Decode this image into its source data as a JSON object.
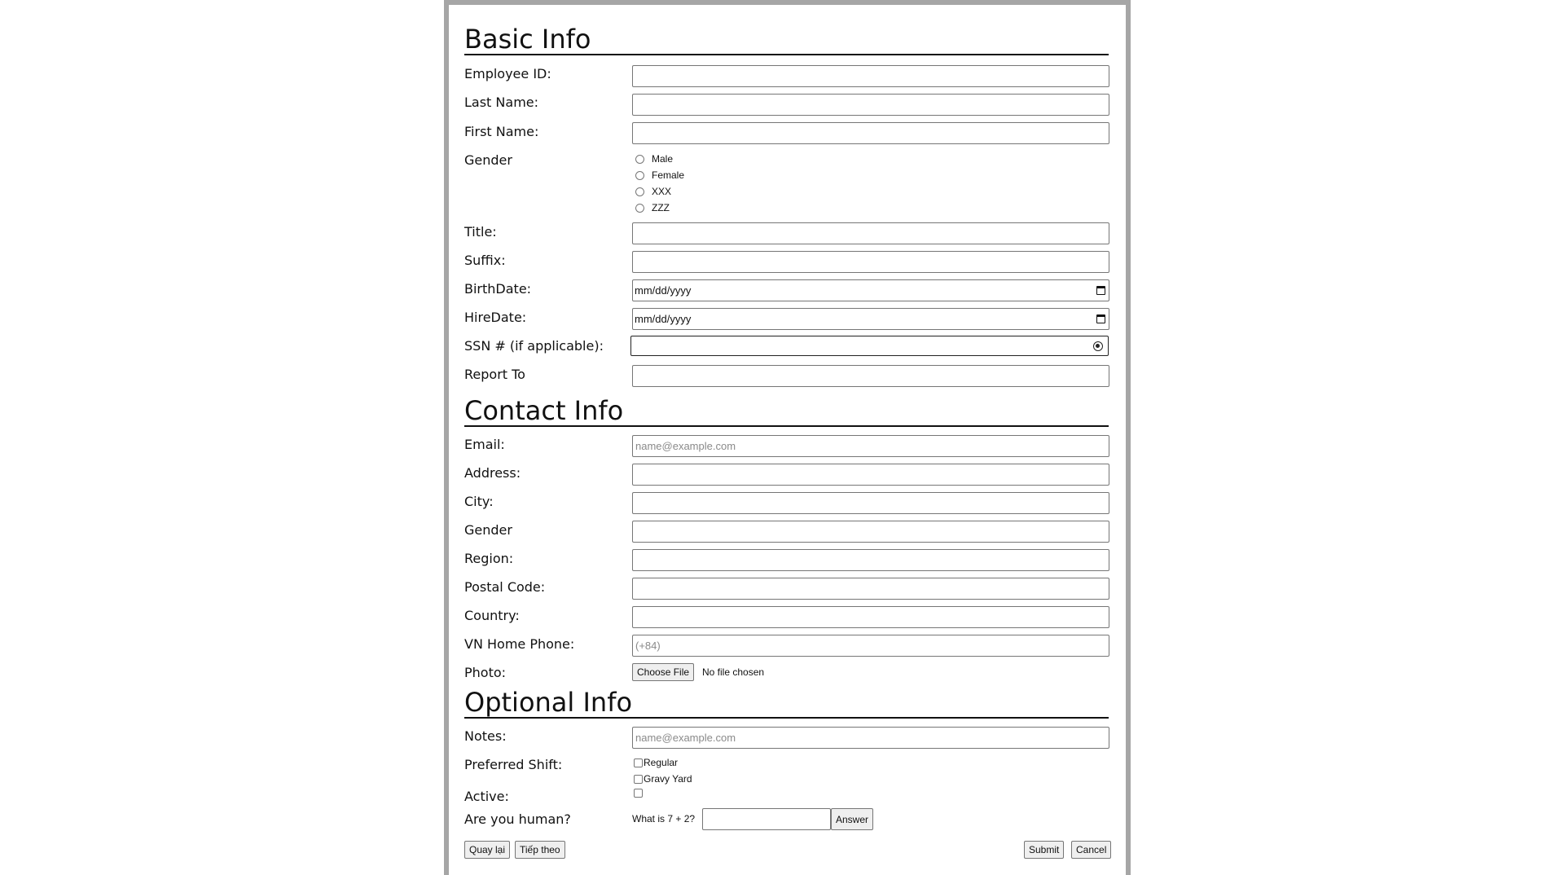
{
  "sections": {
    "basic": "Basic Info",
    "contact": "Contact Info",
    "optional": "Optional Info"
  },
  "basic": {
    "employee_id": "Employee ID:",
    "last_name": "Last Name:",
    "first_name": "First Name:",
    "gender": "Gender",
    "gender_options": [
      "Male",
      "Female",
      "XXX",
      "ZZZ"
    ],
    "title": "Title:",
    "suffix": "Suffix:",
    "birth_date": "BirthDate:",
    "hire_date": "HireDate:",
    "date_placeholder": "mm/dd/yyyy",
    "ssn": "SSN # (if applicable):",
    "report_to": "Report To"
  },
  "contact": {
    "email": "Email:",
    "email_placeholder": "name@example.com",
    "address": "Address:",
    "city": "City:",
    "gender": "Gender",
    "region": "Region:",
    "postal_code": "Postal Code:",
    "country": "Country:",
    "home_phone": "VN Home Phone:",
    "phone_placeholder": "(+84)",
    "photo": "Photo:",
    "choose_file": "Choose File",
    "no_file": "No file chosen"
  },
  "optional": {
    "notes": "Notes:",
    "notes_placeholder": "name@example.com",
    "preferred_shift": "Preferred Shift:",
    "shift_options": [
      "Regular",
      "Gravy Yard"
    ],
    "active": "Active:",
    "human": "Are you human?",
    "question": "What is 7 + 2?",
    "answer": "Answer"
  },
  "buttons": {
    "back": "Quay lại",
    "next": "Tiếp theo",
    "submit": "Submit",
    "cancel": "Cancel"
  },
  "colors": {
    "frame_border": "#a6a6a6",
    "field_border": "#767676",
    "button_bg": "#efefef"
  }
}
